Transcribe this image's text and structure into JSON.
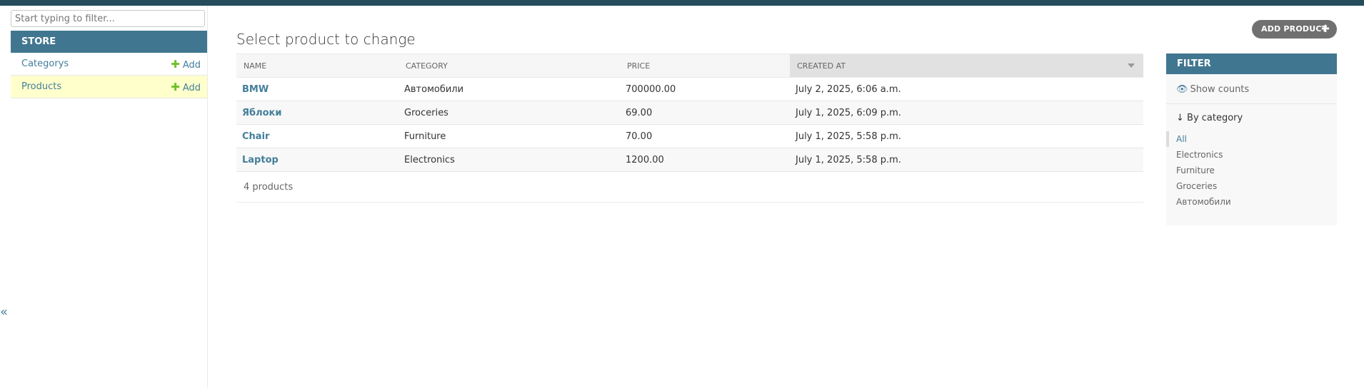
{
  "sidebar": {
    "filter_placeholder": "Start typing to filter...",
    "app_name": "STORE",
    "models": [
      {
        "name": "Categorys",
        "add_label": "Add"
      },
      {
        "name": "Products",
        "add_label": "Add"
      }
    ],
    "collapse_glyph": "«"
  },
  "main": {
    "title": "Select product to change",
    "add_button": "ADD PRODUCT",
    "columns": [
      "NAME",
      "CATEGORY",
      "PRICE",
      "CREATED AT"
    ],
    "rows": [
      {
        "name": "BMW",
        "category": "Автомобили",
        "price": "700000.00",
        "created_at": "July 2, 2025, 6:06 a.m."
      },
      {
        "name": "Яблоки",
        "category": "Groceries",
        "price": "69.00",
        "created_at": "July 1, 2025, 6:09 p.m."
      },
      {
        "name": "Chair",
        "category": "Furniture",
        "price": "70.00",
        "created_at": "July 1, 2025, 5:58 p.m."
      },
      {
        "name": "Laptop",
        "category": "Electronics",
        "price": "1200.00",
        "created_at": "July 1, 2025, 5:58 p.m."
      }
    ],
    "result_count": "4 products"
  },
  "filter": {
    "header": "FILTER",
    "show_counts": "Show counts",
    "by_category": "↓ By category",
    "options": [
      "All",
      "Electronics",
      "Furniture",
      "Groceries",
      "Автомобили"
    ],
    "selected": "All"
  },
  "colors": {
    "topbar": "#264b5d",
    "header": "#417690",
    "link": "#447e9b",
    "add_plus": "#70bf2b",
    "selected_row": "#ffffcc"
  }
}
